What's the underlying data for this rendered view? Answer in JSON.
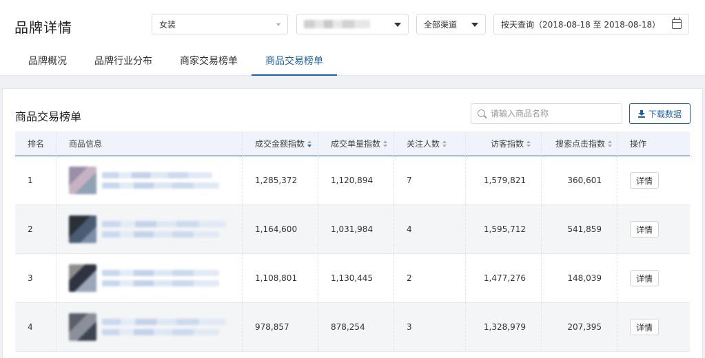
{
  "header": {
    "title": "品牌详情",
    "category_select": "女装",
    "channel_select": "全部渠道",
    "date_query": "按天查询（2018-08-18 至 2018-08-18）"
  },
  "tabs": [
    {
      "label": "品牌概况",
      "active": false
    },
    {
      "label": "品牌行业分布",
      "active": false
    },
    {
      "label": "商家交易榜单",
      "active": false
    },
    {
      "label": "商品交易榜单",
      "active": true
    }
  ],
  "section": {
    "title": "商品交易榜单",
    "search_placeholder": "请输入商品名称",
    "download_label": "下载数据"
  },
  "table": {
    "columns": [
      "排名",
      "商品信息",
      "成交金额指数",
      "成交单量指数",
      "关注人数",
      "访客指数",
      "搜索点击指数",
      "操作"
    ],
    "rows": [
      {
        "rank": "1",
        "amount": "1,285,372",
        "orders": "1,120,894",
        "followers": "7",
        "visitors": "1,579,821",
        "search_clicks": "360,601",
        "action": "详情"
      },
      {
        "rank": "2",
        "amount": "1,164,600",
        "orders": "1,031,984",
        "followers": "4",
        "visitors": "1,595,712",
        "search_clicks": "541,859",
        "action": "详情"
      },
      {
        "rank": "3",
        "amount": "1,108,801",
        "orders": "1,130,445",
        "followers": "2",
        "visitors": "1,477,276",
        "search_clicks": "148,039",
        "action": "详情"
      },
      {
        "rank": "4",
        "amount": "978,857",
        "orders": "878,254",
        "followers": "3",
        "visitors": "1,328,979",
        "search_clicks": "207,395",
        "action": "详情"
      }
    ]
  },
  "colors": {
    "accent": "#1f5fa8",
    "header_bg": "#f0f4fa",
    "alt_row_bg": "#f4f5f7"
  }
}
